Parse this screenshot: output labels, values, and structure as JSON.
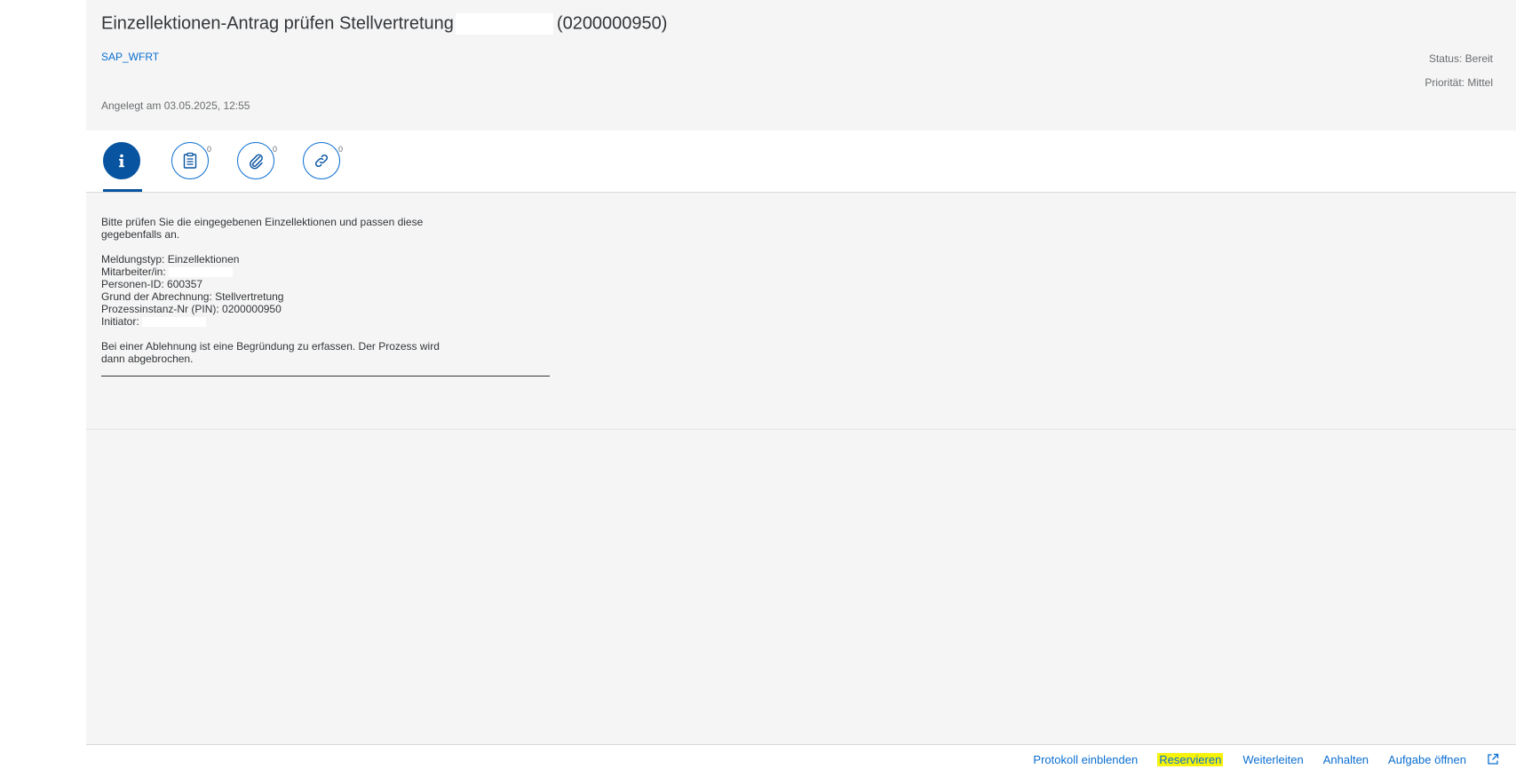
{
  "header": {
    "title_prefix": "Einzellektionen-Antrag prüfen Stellvertretung",
    "title_suffix": "(0200000950)",
    "system_link": "SAP_WFRT",
    "created": "Angelegt am 03.05.2025, 12:55",
    "status": "Status: Bereit",
    "priority": "Priorität: Mittel"
  },
  "tabs": [
    {
      "name": "info",
      "icon": "info-icon",
      "count": ""
    },
    {
      "name": "notes",
      "icon": "notes-icon",
      "count": "0"
    },
    {
      "name": "attachments",
      "icon": "paperclip-icon",
      "count": "0"
    },
    {
      "name": "links",
      "icon": "link-icon",
      "count": "0"
    }
  ],
  "content": {
    "intro_line1": "Bitte prüfen Sie die eingegebenen Einzellektionen und passen diese",
    "intro_line2": "gegebenfalls an.",
    "meldungstyp": "Meldungstyp: Einzellektionen",
    "mitarbeiter": "Mitarbeiter/in:",
    "personen_id": "Personen-ID: 600357",
    "grund": "Grund der Abrechnung: Stellvertretung",
    "pin": "Prozessinstanz-Nr (PIN): 0200000950",
    "initiator": "Initiator:",
    "note_line1": "Bei einer Ablehnung ist eine Begründung zu erfassen. Der Prozess wird",
    "note_line2": "dann abgebrochen."
  },
  "footer": {
    "protokoll": "Protokoll einblenden",
    "reservieren": "Reservieren",
    "weiterleiten": "Weiterleiten",
    "anhalten": "Anhalten",
    "aufgabe_oeffnen": "Aufgabe öffnen"
  },
  "colors": {
    "accent": "#0a6ed1",
    "active_tab": "#0854a0",
    "highlight": "#f7f20a",
    "background": "#f5f5f5"
  }
}
